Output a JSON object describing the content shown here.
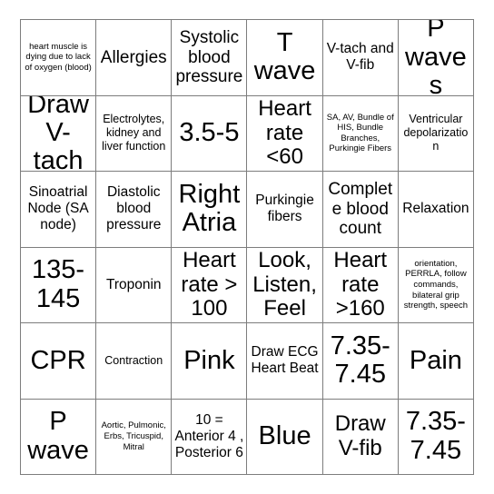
{
  "card": {
    "title": "Bingo Card",
    "columns": 6,
    "rows": 6,
    "border_color": "#7d7d7d",
    "cell_background": "#ffffff",
    "text_color": "#000000",
    "cells": [
      {
        "text": "heart muscle is dying due to lack of oxygen (blood)",
        "size": "xs"
      },
      {
        "text": "Allergies",
        "size": "lg"
      },
      {
        "text": "Systolic blood pressure",
        "size": "lg"
      },
      {
        "text": "T wave",
        "size": "xxl"
      },
      {
        "text": "V-tach and V-fib",
        "size": "md"
      },
      {
        "text": "P waves",
        "size": "xxl"
      },
      {
        "text": "Draw V-tach",
        "size": "xxl"
      },
      {
        "text": "Electrolytes, kidney and liver function",
        "size": "sm"
      },
      {
        "text": "3.5-5",
        "size": "xxl"
      },
      {
        "text": "Heart rate <60",
        "size": "xl"
      },
      {
        "text": "SA, AV, Bundle of HIS, Bundle Branches, Purkingie Fibers",
        "size": "xs"
      },
      {
        "text": "Ventricular depolarization",
        "size": "sm"
      },
      {
        "text": "Sinoatrial Node (SA node)",
        "size": "md"
      },
      {
        "text": "Diastolic blood pressure",
        "size": "md"
      },
      {
        "text": "Right Atria",
        "size": "xxl"
      },
      {
        "text": "Purkingie fibers",
        "size": "md"
      },
      {
        "text": "Complete blood count",
        "size": "lg"
      },
      {
        "text": "Relaxation",
        "size": "md"
      },
      {
        "text": "135-145",
        "size": "xxl"
      },
      {
        "text": "Troponin",
        "size": "md"
      },
      {
        "text": "Heart rate > 100",
        "size": "xl"
      },
      {
        "text": "Look, Listen, Feel",
        "size": "xl"
      },
      {
        "text": "Heart rate >160",
        "size": "xl"
      },
      {
        "text": "orientation, PERRLA, follow commands, bilateral grip strength, speech",
        "size": "xs"
      },
      {
        "text": "CPR",
        "size": "xxl"
      },
      {
        "text": "Contraction",
        "size": "sm"
      },
      {
        "text": "Pink",
        "size": "xxl"
      },
      {
        "text": "Draw ECG Heart Beat",
        "size": "md"
      },
      {
        "text": "7.35-7.45",
        "size": "xxl"
      },
      {
        "text": "Pain",
        "size": "xxl"
      },
      {
        "text": "P wave",
        "size": "xxl"
      },
      {
        "text": "Aortic, Pulmonic, Erbs, Tricuspid, Mitral",
        "size": "xs"
      },
      {
        "text": "10 = Anterior 4 , Posterior 6",
        "size": "md"
      },
      {
        "text": "Blue",
        "size": "xxl"
      },
      {
        "text": "Draw V-fib",
        "size": "xl"
      },
      {
        "text": "7.35-7.45",
        "size": "xxl"
      }
    ]
  }
}
